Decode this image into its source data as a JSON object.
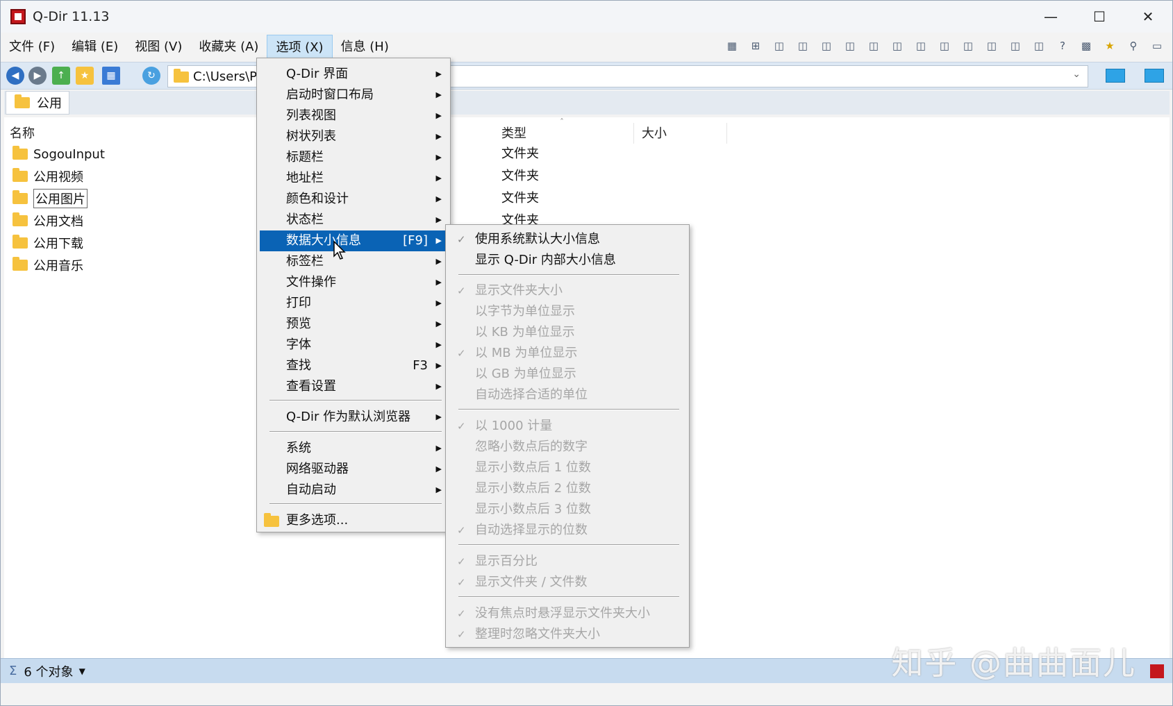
{
  "window": {
    "title": "Q-Dir 11.13"
  },
  "menubar": {
    "items": [
      "文件 (F)",
      "编辑 (E)",
      "视图 (V)",
      "收藏夹 (A)",
      "选项 (X)",
      "信息 (H)"
    ]
  },
  "address": {
    "path": "C:\\Users\\Pu"
  },
  "tab": {
    "label": "公用"
  },
  "list": {
    "columns": {
      "name": "名称",
      "type": "类型",
      "size": "大小"
    },
    "rows": [
      {
        "name": "SogouInput",
        "type": "文件夹"
      },
      {
        "name": "公用视频",
        "type": "文件夹"
      },
      {
        "name": "公用图片",
        "type": "文件夹"
      },
      {
        "name": "公用文档",
        "type": "文件夹"
      },
      {
        "name": "公用下载"
      },
      {
        "name": "公用音乐"
      }
    ]
  },
  "options_menu": {
    "items": [
      {
        "label": "Q-Dir 界面"
      },
      {
        "label": "启动时窗口布局"
      },
      {
        "label": "列表视图"
      },
      {
        "label": "树状列表"
      },
      {
        "label": "标题栏"
      },
      {
        "label": "地址栏"
      },
      {
        "label": "颜色和设计"
      },
      {
        "label": "状态栏"
      },
      {
        "label": "数据大小信息",
        "shortcut": "[F9]"
      },
      {
        "label": "标签栏"
      },
      {
        "label": "文件操作"
      },
      {
        "label": "打印"
      },
      {
        "label": "预览"
      },
      {
        "label": "字体"
      },
      {
        "label": "查找",
        "shortcut": "F3"
      },
      {
        "label": "查看设置"
      },
      {
        "label": "Q-Dir 作为默认浏览器"
      },
      {
        "label": "系统"
      },
      {
        "label": "网络驱动器"
      },
      {
        "label": "自动启动"
      },
      {
        "label": "更多选项..."
      }
    ]
  },
  "size_submenu": {
    "items": [
      {
        "label": "使用系统默认大小信息"
      },
      {
        "label": "显示 Q-Dir 内部大小信息"
      },
      {
        "label": "显示文件夹大小"
      },
      {
        "label": "以字节为单位显示"
      },
      {
        "label": "以 KB 为单位显示"
      },
      {
        "label": "以 MB 为单位显示"
      },
      {
        "label": "以 GB 为单位显示"
      },
      {
        "label": "自动选择合适的单位"
      },
      {
        "label": "以 1000 计量"
      },
      {
        "label": "忽略小数点后的数字"
      },
      {
        "label": "显示小数点后 1 位数"
      },
      {
        "label": "显示小数点后 2 位数"
      },
      {
        "label": "显示小数点后 3 位数"
      },
      {
        "label": "自动选择显示的位数"
      },
      {
        "label": "显示百分比"
      },
      {
        "label": "显示文件夹 / 文件数"
      },
      {
        "label": "没有焦点时悬浮显示文件夹大小"
      },
      {
        "label": "整理时忽略文件夹大小"
      }
    ]
  },
  "statusbar": {
    "text": "6 个对象"
  },
  "watermark": {
    "text": "知乎 @曲曲面儿"
  },
  "colors": {
    "accent": "#0a63b5",
    "folder": "#f6c23e",
    "statusbar": "#c7dbef"
  }
}
